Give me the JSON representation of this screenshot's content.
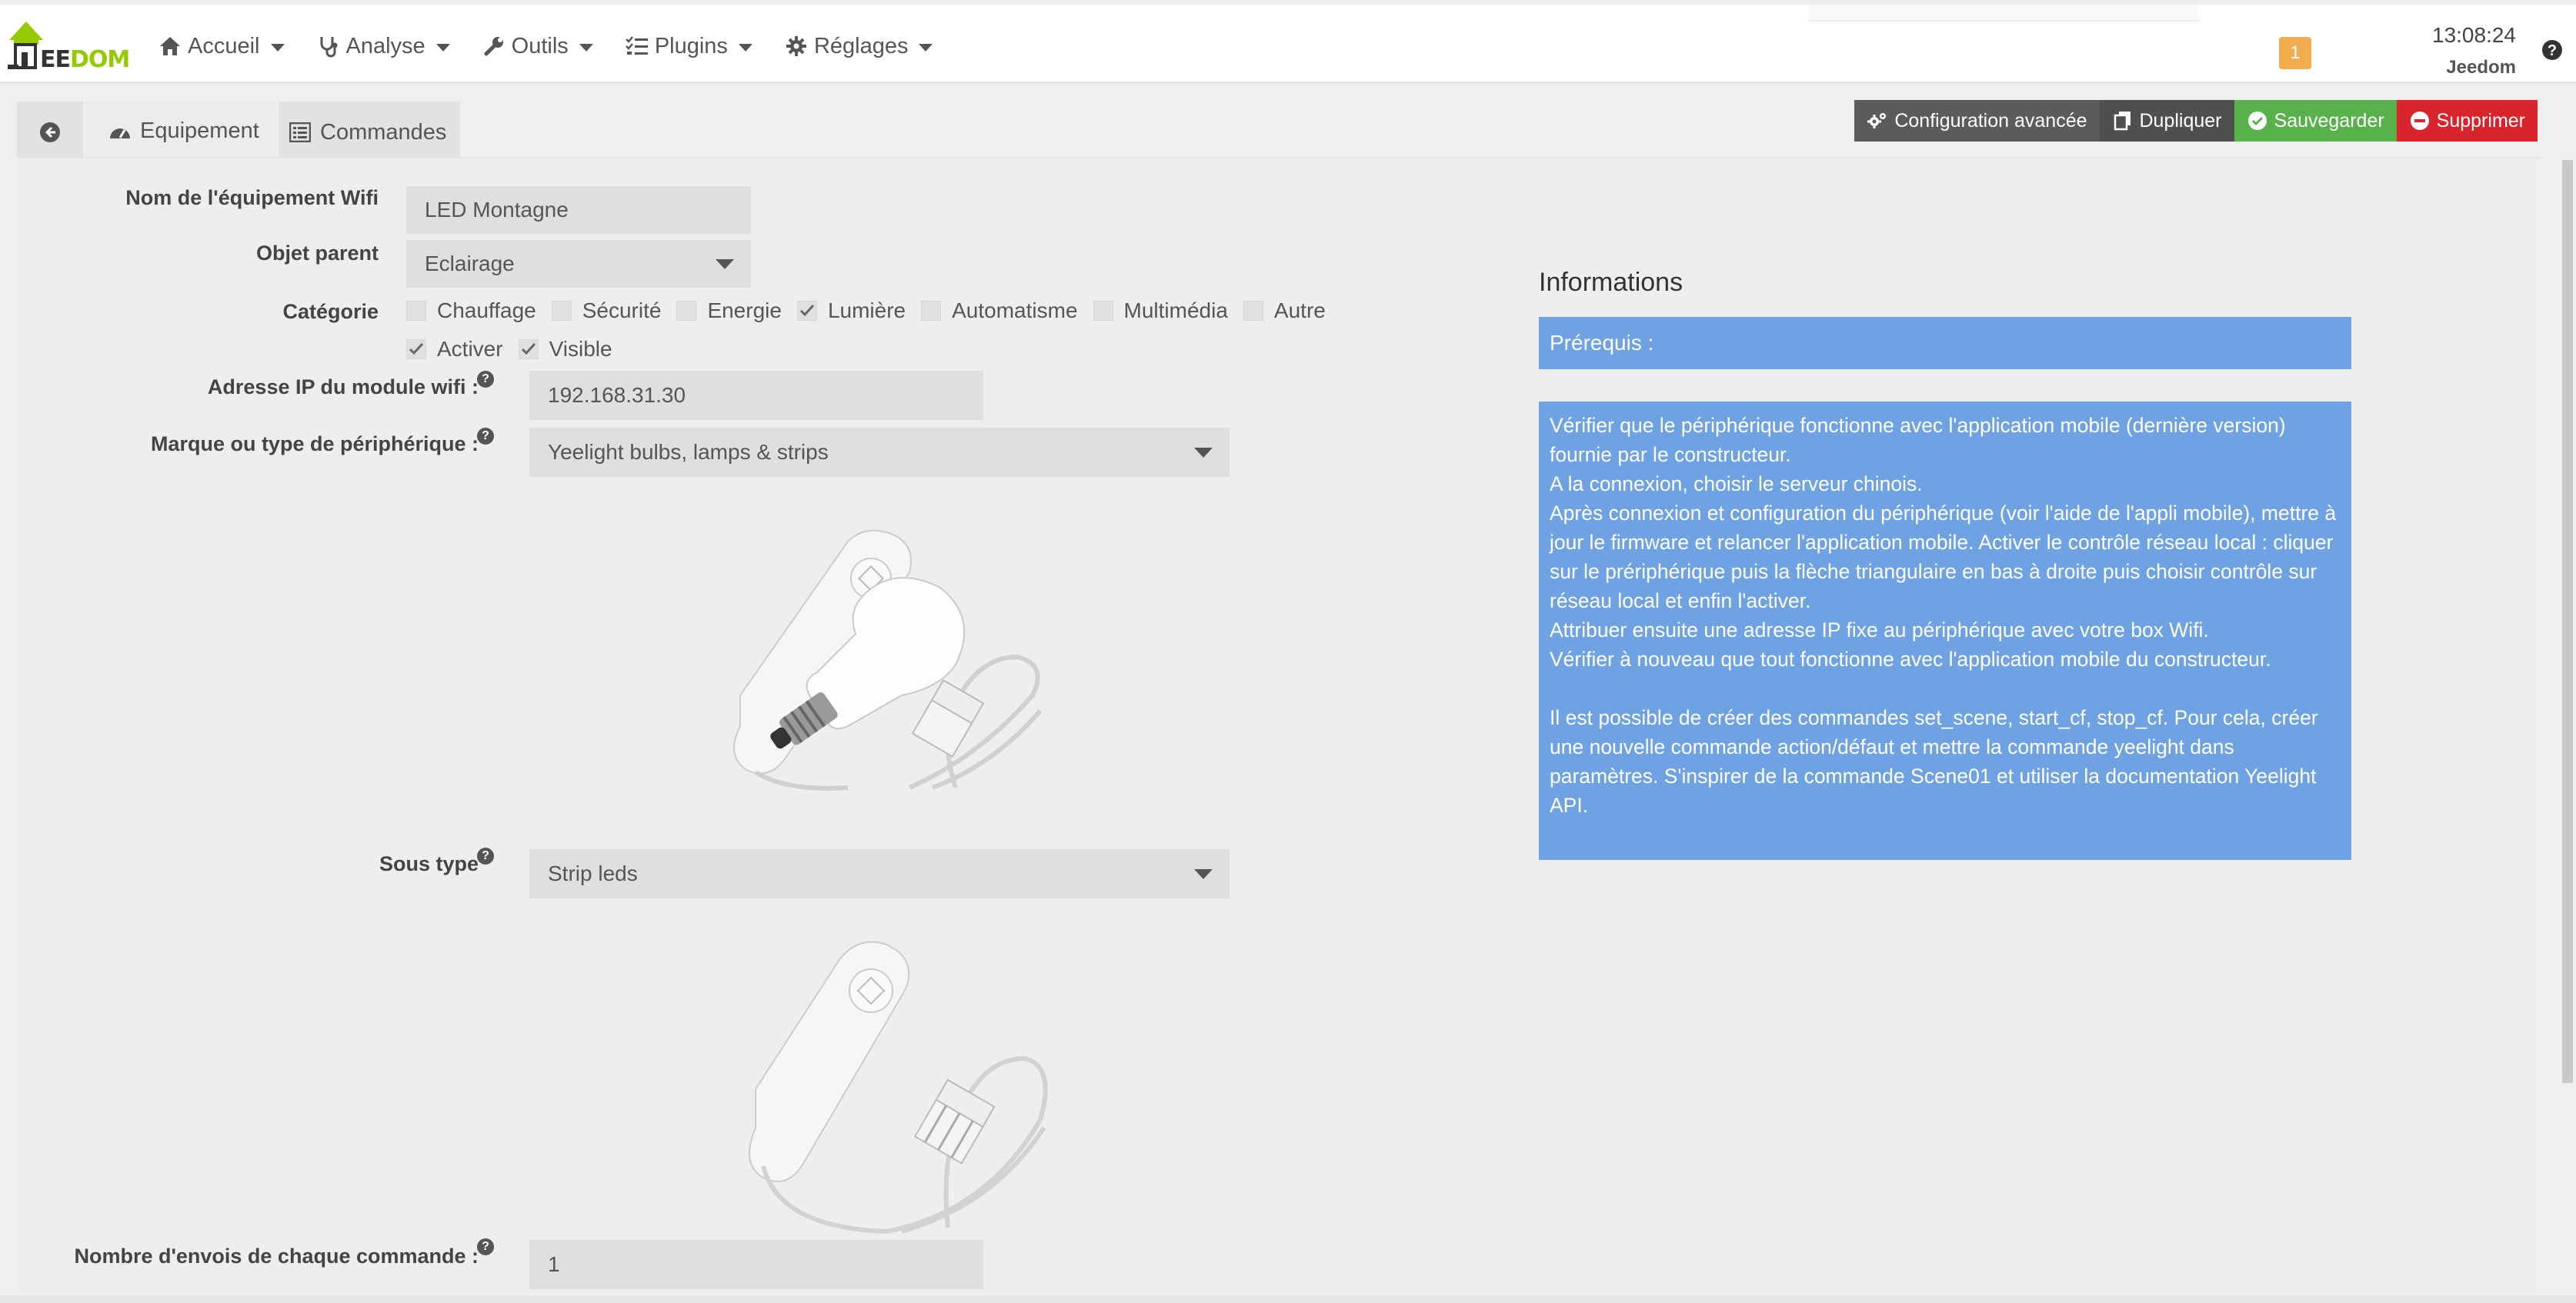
{
  "brand": {
    "text_a": "EE",
    "text_b": "DOM"
  },
  "nav": {
    "items": [
      {
        "label": "Accueil",
        "icon": "home-icon"
      },
      {
        "label": "Analyse",
        "icon": "stethoscope-icon"
      },
      {
        "label": "Outils",
        "icon": "wrench-icon"
      },
      {
        "label": "Plugins",
        "icon": "tasks-icon"
      },
      {
        "label": "Réglages",
        "icon": "gear-icon"
      }
    ],
    "notif_count": "1",
    "time": "13:08:24",
    "user": "Jeedom"
  },
  "tabs": {
    "equipement": "Equipement",
    "commandes": "Commandes"
  },
  "actions": {
    "config": "Configuration avancée",
    "duplicate": "Dupliquer",
    "save": "Sauvegarder",
    "delete": "Supprimer"
  },
  "form": {
    "name_label": "Nom de l'équipement Wifi",
    "name_value": "LED Montagne",
    "parent_label": "Objet parent",
    "parent_value": "Eclairage",
    "category_label": "Catégorie",
    "categories": [
      {
        "label": "Chauffage",
        "checked": false
      },
      {
        "label": "Sécurité",
        "checked": false
      },
      {
        "label": "Energie",
        "checked": false
      },
      {
        "label": "Lumière",
        "checked": true
      },
      {
        "label": "Automatisme",
        "checked": false
      },
      {
        "label": "Multimédia",
        "checked": false
      },
      {
        "label": "Autre",
        "checked": false
      }
    ],
    "enable_label": "Activer",
    "visible_label": "Visible",
    "ip_label": "Adresse IP du module wifi :",
    "ip_value": "192.168.31.30",
    "brand_label": "Marque ou type de périphérique :",
    "brand_value": "Yeelight bulbs, lamps & strips",
    "subtype_label": "Sous type",
    "subtype_value": "Strip leds",
    "sends_label": "Nombre d'envois de chaque commande :",
    "sends_value": "1"
  },
  "info": {
    "title": "Informations",
    "prereq": "Prérequis :",
    "lines": [
      "Vérifier que le périphérique fonctionne avec l'application mobile (dernière version) fournie par le constructeur.",
      "A la connexion, choisir le serveur chinois.",
      "Après connexion et configuration du périphérique (voir l'aide de l'appli mobile), mettre à jour le firmware et relancer l'application mobile. Activer le contrôle réseau local : cliquer sur le prériphérique puis la flèche triangulaire en bas à droite puis choisir contrôle sur réseau local et enfin l'activer.",
      "Attribuer ensuite une adresse IP fixe au périphérique avec votre box Wifi.",
      "Vérifier à nouveau que tout fonctionne avec l'application mobile du constructeur."
    ],
    "extra": "Il est possible de créer des commandes set_scene, start_cf, stop_cf. Pour cela, créer une nouvelle commande action/défaut et mettre la commande yeelight dans paramètres. S'inspirer de la commande Scene01 et utiliser la documentation Yeelight API."
  }
}
